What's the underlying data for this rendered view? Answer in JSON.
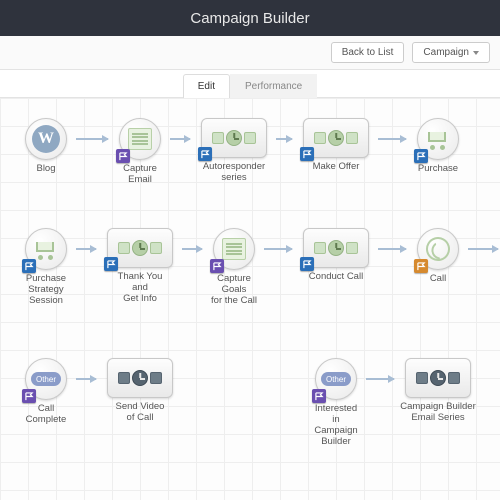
{
  "header": {
    "title": "Campaign Builder"
  },
  "toolbar": {
    "back_label": "Back to List",
    "menu_label": "Campaign"
  },
  "tabs": {
    "edit_label": "Edit",
    "performance_label": "Performance",
    "active": "edit"
  },
  "canvas": {
    "rows": [
      {
        "nodes": [
          {
            "id": "blog",
            "kind": "circle",
            "icon": "wordpress",
            "label": "Blog",
            "flag": null
          },
          {
            "id": "capture-email",
            "kind": "circle",
            "icon": "form",
            "label": "Capture Email",
            "flag": "purple"
          },
          {
            "id": "autoresponder",
            "kind": "sequence",
            "icon": "sequence",
            "label": "Autoresponder series",
            "flag": "blue"
          },
          {
            "id": "make-offer",
            "kind": "sequence",
            "icon": "sequence",
            "label": "Make Offer",
            "flag": "blue"
          },
          {
            "id": "purchase",
            "kind": "circle",
            "icon": "cart",
            "label": "Purchase",
            "flag": "blue"
          }
        ],
        "arrows": [
          [
            0,
            1
          ],
          [
            1,
            2
          ],
          [
            2,
            3
          ],
          [
            3,
            4
          ]
        ]
      },
      {
        "nodes": [
          {
            "id": "purchase-strategy",
            "kind": "circle",
            "icon": "cart",
            "label": "Purchase Strategy\nSession",
            "flag": "blue"
          },
          {
            "id": "thank-you",
            "kind": "sequence",
            "icon": "sequence",
            "label": "Thank You\nand\nGet Info",
            "flag": "blue"
          },
          {
            "id": "capture-goals",
            "kind": "circle",
            "icon": "form",
            "label": "Capture Goals\nfor the Call",
            "flag": "purple"
          },
          {
            "id": "conduct-call",
            "kind": "sequence",
            "icon": "sequence",
            "label": "Conduct Call",
            "flag": "blue"
          },
          {
            "id": "call",
            "kind": "circle",
            "icon": "phone",
            "label": "Call",
            "flag": "orange"
          }
        ],
        "arrows": [
          [
            0,
            1
          ],
          [
            1,
            2
          ],
          [
            2,
            3
          ],
          [
            3,
            4
          ],
          [
            4,
            5
          ]
        ]
      },
      {
        "nodes": [
          {
            "id": "call-complete",
            "kind": "circle",
            "icon": "other",
            "label": "Call Complete",
            "flag": "purple"
          },
          {
            "id": "send-video",
            "kind": "sequence-dark",
            "icon": "sequence-dark",
            "label": "Send Video\nof Call",
            "flag": null
          },
          null,
          {
            "id": "interested",
            "kind": "circle",
            "icon": "other",
            "label": "Interested\nin\nCampaign\nBuilder",
            "flag": "purple"
          },
          {
            "id": "email-series",
            "kind": "sequence-dark",
            "icon": "sequence-dark",
            "label": "Campaign Builder\nEmail Series",
            "flag": null
          }
        ],
        "arrows": [
          [
            0,
            1
          ],
          [
            3,
            4
          ]
        ]
      }
    ]
  },
  "flag_colors": {
    "blue": "#2b6fb8",
    "purple": "#6a4fb0",
    "orange": "#d68a2f"
  },
  "other_label": "Other"
}
